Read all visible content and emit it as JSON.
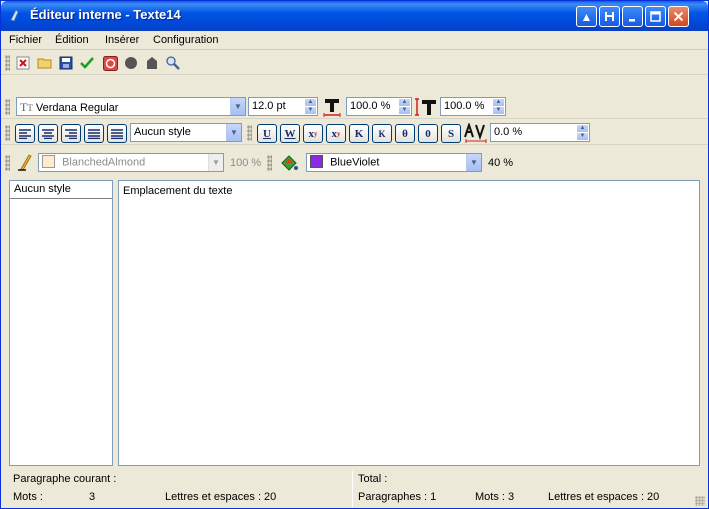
{
  "window": {
    "title": "Éditeur interne - Texte14"
  },
  "menu": [
    "Fichier",
    "Édition",
    "Insérer",
    "Configuration"
  ],
  "font": {
    "name": "Verdana Regular",
    "size": "12.0 pt",
    "width_scale": "100.0 %",
    "height_scale": "100.0 %"
  },
  "paragraph": {
    "style": "Aucun style",
    "spacing": "0.0 %"
  },
  "format_buttons": [
    "U",
    "W",
    "x",
    "x",
    "K",
    "K",
    "θ",
    "0",
    "S"
  ],
  "colors": {
    "background_name": "BlanchedAlmond",
    "background_hex": "#FFEBCD",
    "background_opacity": "100 %",
    "text_name": "BlueViolet",
    "text_hex": "#8A2BE2",
    "text_opacity": "40 %"
  },
  "styles_panel": {
    "header": "Aucun style"
  },
  "editor": {
    "text": "Emplacement du texte"
  },
  "status": {
    "current_para_label": "Paragraphe courant :",
    "words_label": "Mots :",
    "words_value": "3",
    "letters_label": "Lettres et espaces : 20",
    "total_label": "Total :",
    "total_paragraphs": "Paragraphes : 1",
    "total_words": "Mots : 3",
    "total_letters": "Lettres et espaces : 20"
  }
}
